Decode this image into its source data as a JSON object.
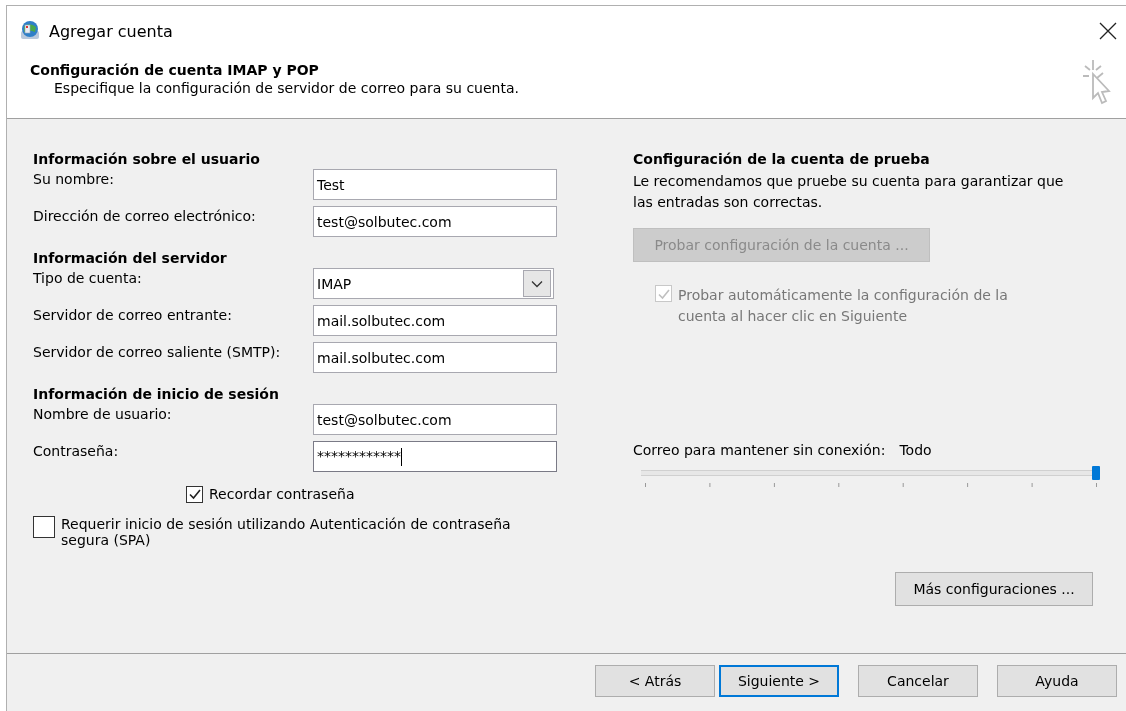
{
  "window": {
    "title": "Agregar cuenta"
  },
  "header": {
    "title": "Configuración de cuenta IMAP y POP",
    "subtitle": "Especifique la configuración de servidor de correo para su cuenta."
  },
  "sections": [
    {
      "heading": "Información sobre el usuario",
      "fields": [
        {
          "label": "Su nombre:",
          "value": "Test",
          "kind": "text",
          "focused": false
        },
        {
          "label": "Dirección de correo electrónico:",
          "value": "test@solbutec.com",
          "kind": "text",
          "focused": false
        }
      ]
    },
    {
      "heading": "Información del servidor",
      "fields": [
        {
          "label": "Tipo de cuenta:",
          "value": "IMAP",
          "kind": "dropdown",
          "focused": false
        },
        {
          "label": "Servidor de correo entrante:",
          "value": "mail.solbutec.com",
          "kind": "text",
          "focused": false
        },
        {
          "label": "Servidor de correo saliente (SMTP):",
          "value": "mail.solbutec.com",
          "kind": "text",
          "focused": false
        }
      ]
    },
    {
      "heading": "Información de inicio de sesión",
      "fields": [
        {
          "label": "Nombre de usuario:",
          "value": "test@solbutec.com",
          "kind": "text",
          "focused": false
        },
        {
          "label": "Contraseña:",
          "value": "************",
          "kind": "password",
          "focused": true
        }
      ]
    }
  ],
  "remember_password": {
    "label": "Recordar contraseña",
    "checked": true
  },
  "require_spa": {
    "label": "Requerir inicio de sesión utilizando Autenticación de contraseña segura (SPA)",
    "checked": false
  },
  "test_settings": {
    "heading": "Configuración de la cuenta de prueba",
    "text": "Le recomendamos que pruebe su cuenta para garantizar que las entradas son correctas.",
    "button": {
      "label": "Probar configuración de la cuenta ...",
      "disabled": true
    },
    "auto_test": {
      "label": "Probar automáticamente la configuración de la cuenta al hacer clic en Siguiente",
      "checked": true,
      "disabled": true
    }
  },
  "offline_mail": {
    "label": "Correo para mantener sin conexión:",
    "reading": "Todo",
    "level": 1
  },
  "more_settings_button": "Más configuraciones ...",
  "buttons": [
    {
      "label": "< Atrás",
      "default": false
    },
    {
      "label": "Siguiente >",
      "default": true
    },
    {
      "label": "Cancelar",
      "default": false
    },
    {
      "label": "Ayuda",
      "default": false
    }
  ]
}
